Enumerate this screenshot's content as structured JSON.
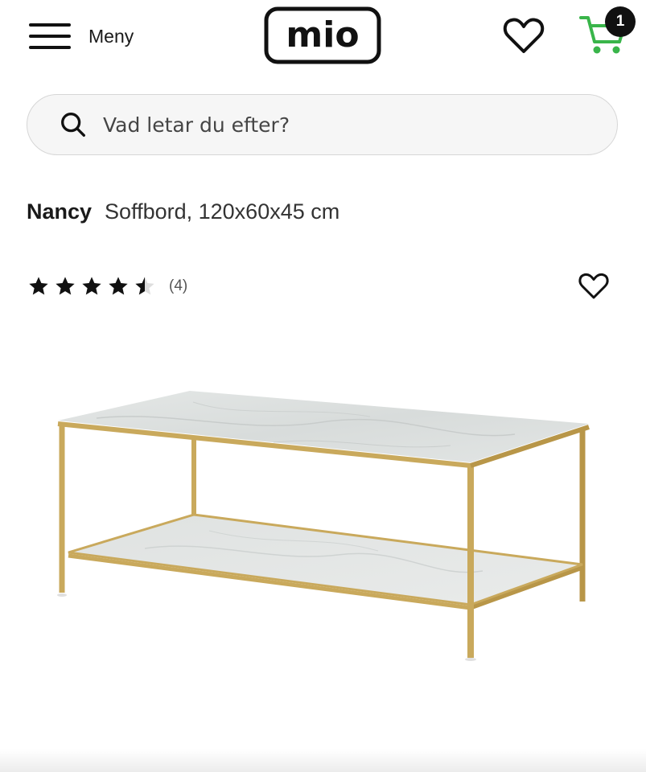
{
  "header": {
    "menu_label": "Meny",
    "logo_text": "mio",
    "cart_count": "1",
    "icons": {
      "menu": "hamburger-icon",
      "wishlist": "heart-icon",
      "cart": "cart-icon"
    },
    "colors": {
      "cart": "#39b54a",
      "badge": "#111111"
    }
  },
  "search": {
    "placeholder": "Vad letar du efter?",
    "icon": "search-icon"
  },
  "product": {
    "brand": "Nancy",
    "subtitle": "Soffbord, 120x60x45 cm",
    "rating": {
      "value": 4.5,
      "max": 5,
      "count_label": "(4)"
    },
    "image": "coffee-table-marble-gold-photo",
    "wishlist_icon": "heart-outline-icon"
  }
}
